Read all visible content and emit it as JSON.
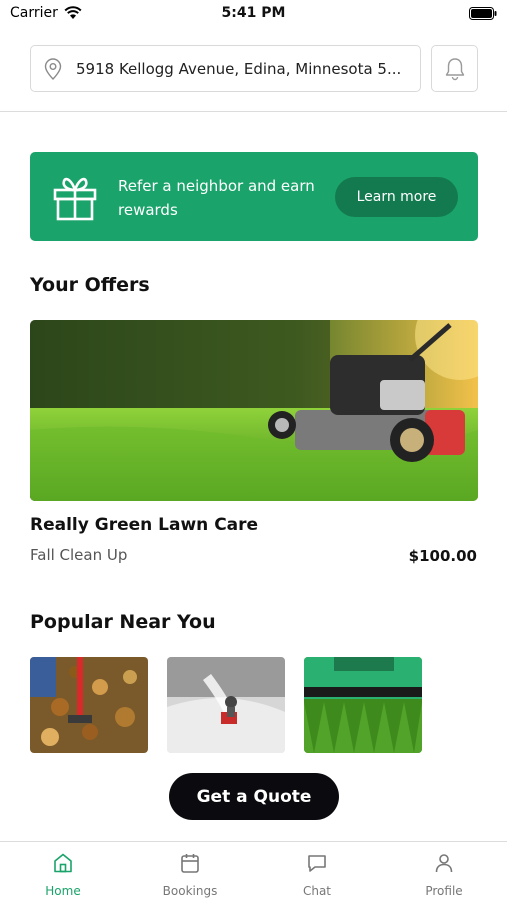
{
  "status_bar": {
    "carrier": "Carrier",
    "time": "5:41 PM"
  },
  "header": {
    "address": "5918 Kellogg Avenue, Edina, Minnesota 5..."
  },
  "referral": {
    "text": "Refer a neighbor and earn rewards",
    "button": "Learn more"
  },
  "offers": {
    "title": "Your Offers",
    "items": [
      {
        "name": "Really Green Lawn Care",
        "service": "Fall Clean Up",
        "price": "$100.00"
      }
    ]
  },
  "popular": {
    "title": "Popular Near You",
    "items": [
      {
        "icon": "leaf-raking-photo"
      },
      {
        "icon": "snow-blower-photo"
      },
      {
        "icon": "lawn-mower-photo"
      }
    ]
  },
  "quote_button": "Get a Quote",
  "tabs": [
    {
      "label": "Home",
      "icon": "home-icon",
      "active": true
    },
    {
      "label": "Bookings",
      "icon": "calendar-icon",
      "active": false
    },
    {
      "label": "Chat",
      "icon": "chat-icon",
      "active": false
    },
    {
      "label": "Profile",
      "icon": "user-icon",
      "active": false
    }
  ],
  "colors": {
    "accent": "#1aa36a",
    "accent_dark": "#137a4f",
    "button_dark": "#0b0b0f"
  }
}
